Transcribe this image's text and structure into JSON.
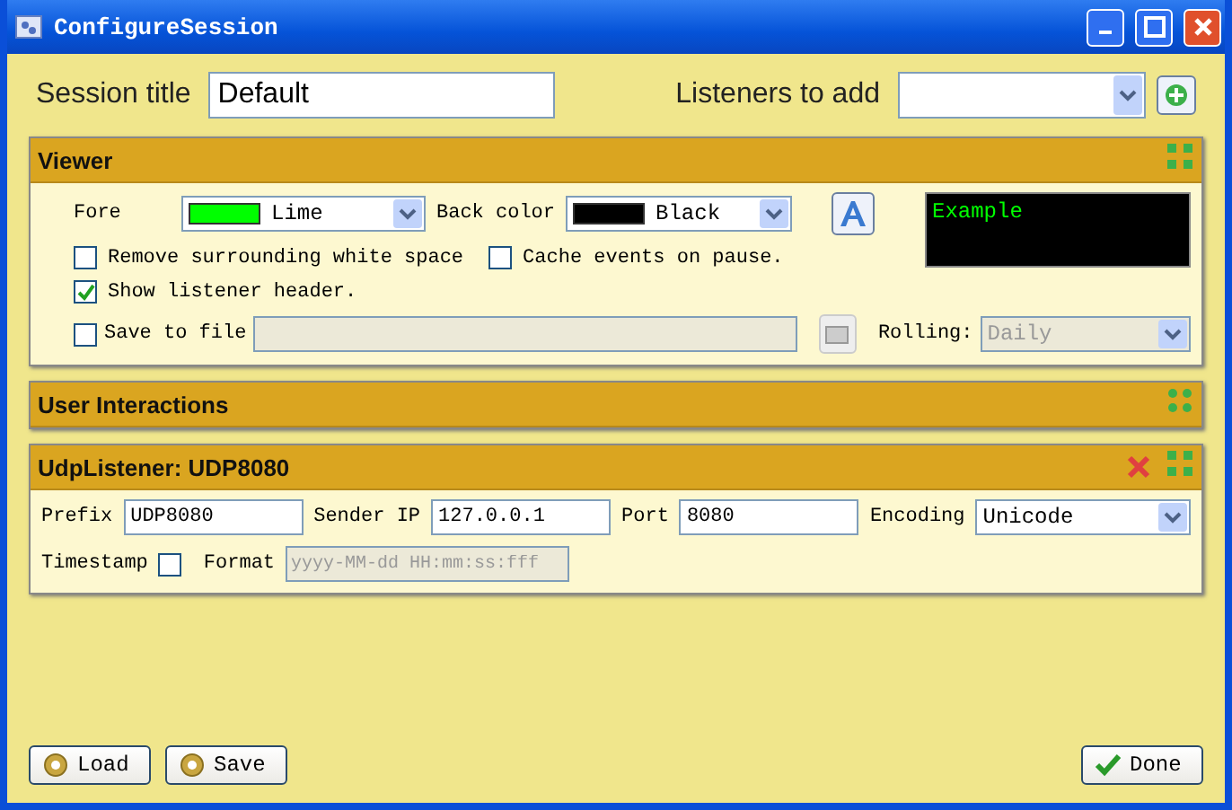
{
  "window": {
    "title": "ConfigureSession"
  },
  "session_title": {
    "label": "Session title",
    "value": "Default"
  },
  "listeners_to_add": {
    "label": "Listeners to add"
  },
  "viewer": {
    "title": "Viewer",
    "expanded": true,
    "fore_color": {
      "label": "Fore",
      "value": "Lime",
      "color": "#00ff00"
    },
    "back_color": {
      "label": "Back color",
      "value": "Black",
      "color": "#000000"
    },
    "example": {
      "text": "Example"
    },
    "options": [
      {
        "label": "Remove surrounding white space",
        "checked": false
      },
      {
        "label": "Cache events on pause.",
        "checked": false
      },
      {
        "label": "Show listener header.",
        "checked": true
      }
    ],
    "save_to_file": {
      "label": "Save to file",
      "checked": false
    },
    "rolling": {
      "label": "Rolling:",
      "value": "Daily",
      "disabled": true
    }
  },
  "user_interactions": {
    "title": "User Interactions",
    "expanded": false
  },
  "udp_listener": {
    "title": "UdpListener: UDP8080",
    "expanded": true,
    "fields": [
      {
        "label": "Prefix",
        "value": "UDP8080"
      },
      {
        "label": "Sender IP",
        "value": "127.0.0.1"
      },
      {
        "label": "Port",
        "value": "8080"
      }
    ],
    "encoding": {
      "label": "Encoding",
      "value": "Unicode"
    },
    "timestamp": {
      "label": "Timestamp",
      "checked": false
    },
    "format": {
      "label": "Format",
      "placeholder": "yyyy-MM-dd HH:mm:ss:fff",
      "disabled": true
    }
  },
  "buttons": [
    {
      "kind": "load",
      "label": "Load"
    },
    {
      "kind": "save",
      "label": "Save"
    },
    {
      "kind": "done",
      "label": "Done"
    }
  ]
}
